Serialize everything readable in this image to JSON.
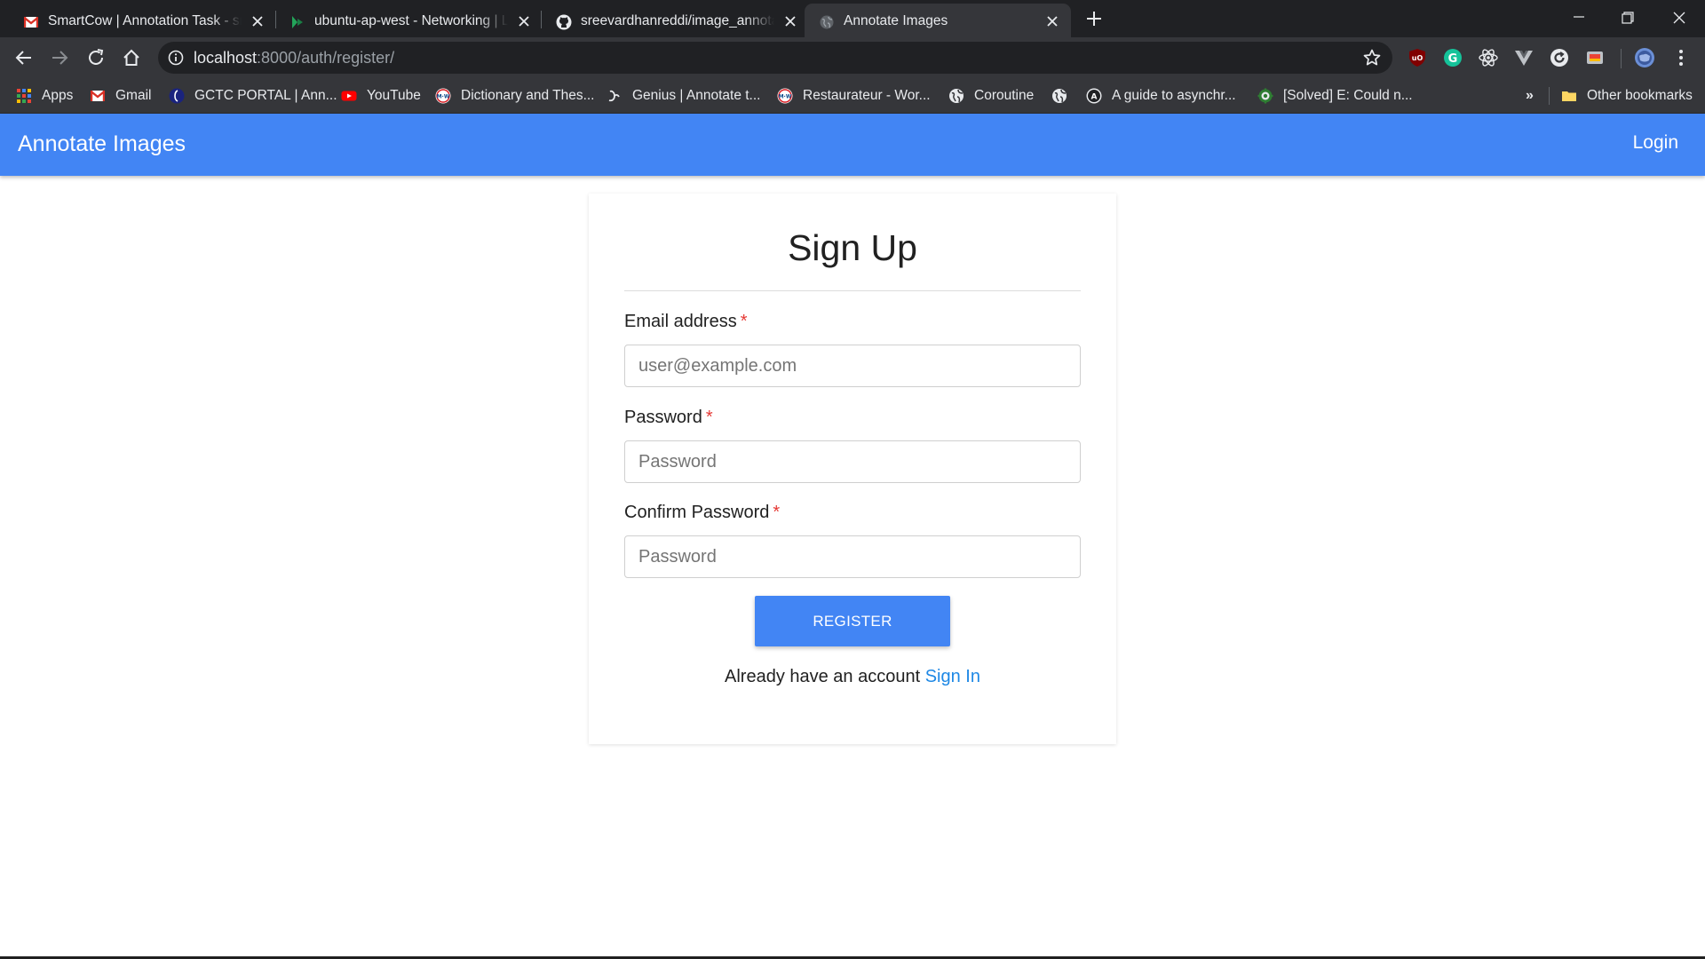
{
  "browser": {
    "tabs": [
      {
        "title": "SmartCow | Annotation Task - sreevardhanreddi",
        "icon": "gmail-icon",
        "active": false
      },
      {
        "title": "ubuntu-ap-west - Networking | Lightsail",
        "icon": "lightsail-icon",
        "active": false
      },
      {
        "title": "sreevardhanreddi/image_annotate",
        "icon": "github-icon",
        "active": false
      },
      {
        "title": "Annotate Images",
        "icon": "globe-icon",
        "active": true
      }
    ],
    "address": {
      "host": "localhost",
      "path": ":8000/auth/register/"
    },
    "bookmarks": [
      {
        "label": "Apps",
        "icon": "apps-grid-icon"
      },
      {
        "label": "Gmail",
        "icon": "gmail-icon"
      },
      {
        "label": "GCTC PORTAL | Ann...",
        "icon": "gctc-icon"
      },
      {
        "label": "YouTube",
        "icon": "youtube-icon"
      },
      {
        "label": "Dictionary and Thes...",
        "icon": "merriam-webster-icon"
      },
      {
        "label": "Genius | Annotate t...",
        "icon": "genius-icon"
      },
      {
        "label": "Restaurateur - Wor...",
        "icon": "merriam-webster-icon"
      },
      {
        "label": "Coroutine",
        "icon": "globe-icon"
      },
      {
        "label": "",
        "icon": "globe-icon"
      },
      {
        "label": "A guide to asynchr...",
        "icon": "angular-icon"
      },
      {
        "label": "[Solved] E: Could n...",
        "icon": "gear-icon"
      }
    ],
    "bookmarks_overflow": "»",
    "other_bookmarks": "Other bookmarks"
  },
  "app": {
    "brand": "Annotate Images",
    "nav_login": "Login"
  },
  "form": {
    "title": "Sign Up",
    "required_mark": "*",
    "email": {
      "label": "Email address",
      "placeholder": "user@example.com"
    },
    "password": {
      "label": "Password",
      "placeholder": "Password"
    },
    "confirm": {
      "label": "Confirm Password",
      "placeholder": "Password"
    },
    "submit": "REGISTER",
    "footer_text": "Already have an account",
    "footer_link": "Sign In"
  },
  "colors": {
    "brand_blue": "#4285f4",
    "link_blue": "#1e88e5",
    "required_red": "#e53935"
  }
}
